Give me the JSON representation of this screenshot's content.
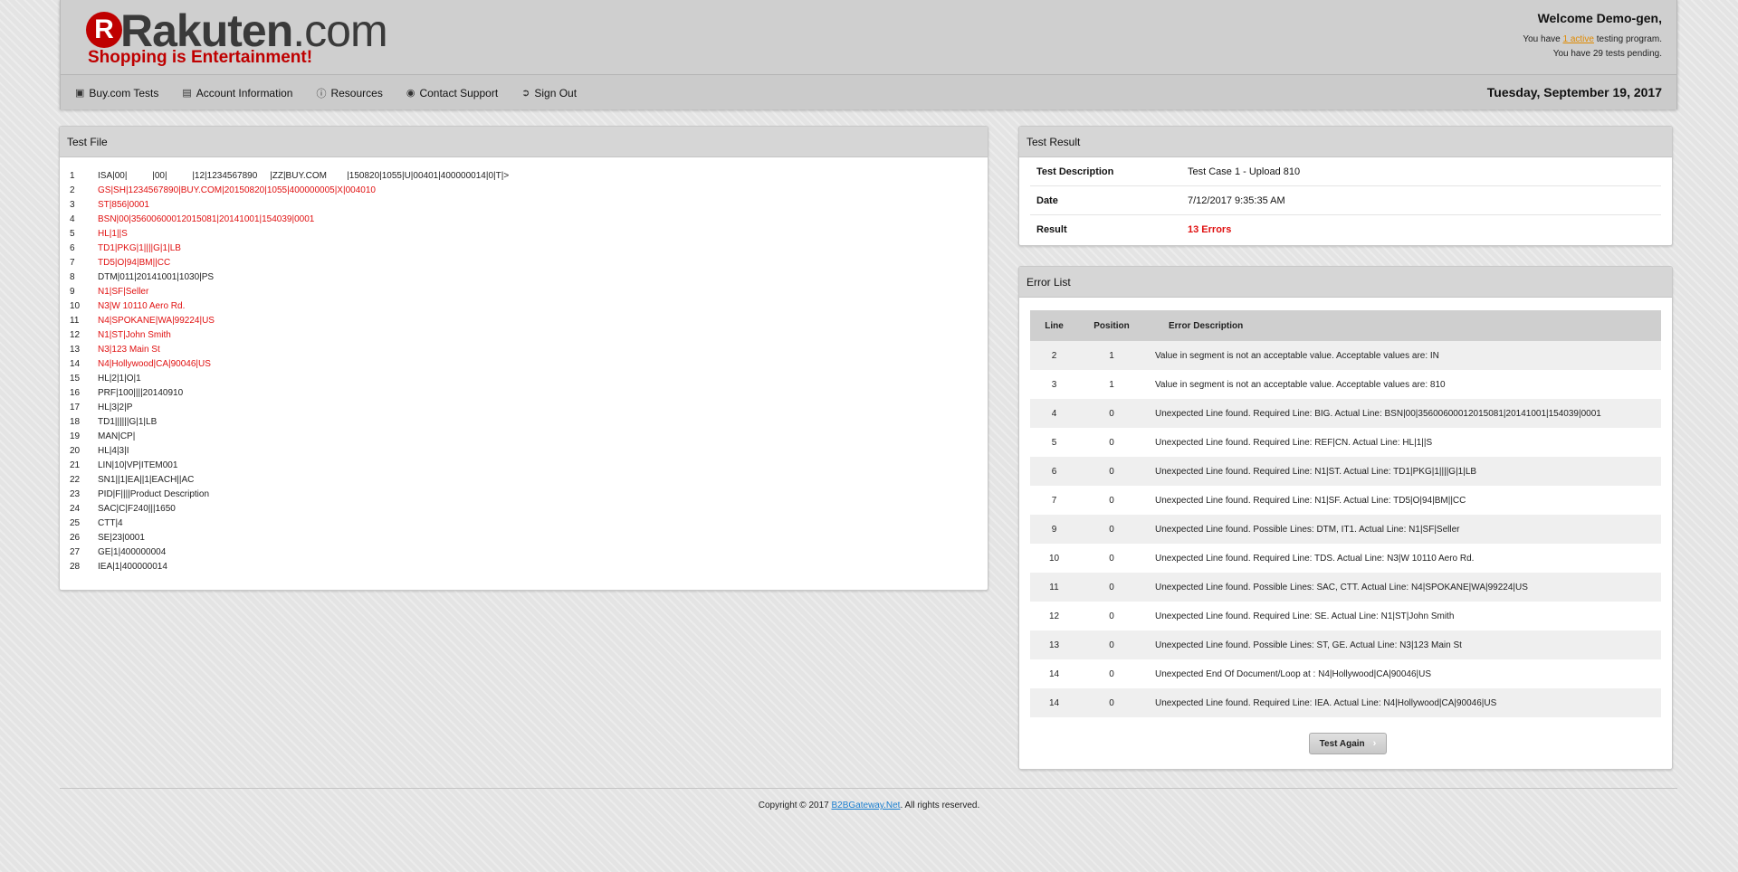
{
  "brand": {
    "logo_letter": "R",
    "logo_name": "Rakuten",
    "logo_suffix": ".com",
    "tagline": "Shopping is Entertainment!"
  },
  "welcome": {
    "title": "Welcome Demo-gen,",
    "line1_prefix": "You have ",
    "line1_link": "1 active",
    "line1_suffix": " testing program.",
    "line2": "You have 29 tests pending."
  },
  "nav": {
    "items": [
      {
        "label": "Buy.com Tests",
        "icon": "document-icon"
      },
      {
        "label": "Account Information",
        "icon": "id-card-icon"
      },
      {
        "label": "Resources",
        "icon": "info-icon"
      },
      {
        "label": "Contact Support",
        "icon": "eye-icon"
      },
      {
        "label": "Sign Out",
        "icon": "sign-out-icon"
      }
    ],
    "date": "Tuesday, September 19, 2017"
  },
  "test_file": {
    "title": "Test File",
    "lines": [
      {
        "n": "1",
        "text": "ISA|00|          |00|          |12|1234567890     |ZZ|BUY.COM        |150820|1055|U|00401|400000014|0|T|>",
        "error": false
      },
      {
        "n": "2",
        "text": "GS|SH|1234567890|BUY.COM|20150820|1055|400000005|X|004010",
        "error": true
      },
      {
        "n": "3",
        "text": "ST|856|0001",
        "error": true
      },
      {
        "n": "4",
        "text": "BSN|00|35600600012015081|20141001|154039|0001",
        "error": true
      },
      {
        "n": "5",
        "text": "HL|1||S",
        "error": true
      },
      {
        "n": "6",
        "text": "TD1|PKG|1||||G|1|LB",
        "error": true
      },
      {
        "n": "7",
        "text": "TD5|O|94|BM||CC",
        "error": true
      },
      {
        "n": "8",
        "text": "DTM|011|20141001|1030|PS",
        "error": false
      },
      {
        "n": "9",
        "text": "N1|SF|Seller",
        "error": true
      },
      {
        "n": "10",
        "text": "N3|W 10110 Aero Rd.",
        "error": true
      },
      {
        "n": "11",
        "text": "N4|SPOKANE|WA|99224|US",
        "error": true
      },
      {
        "n": "12",
        "text": "N1|ST|John Smith",
        "error": true
      },
      {
        "n": "13",
        "text": "N3|123 Main St",
        "error": true
      },
      {
        "n": "14",
        "text": "N4|Hollywood|CA|90046|US",
        "error": true
      },
      {
        "n": "15",
        "text": "HL|2|1|O|1",
        "error": false
      },
      {
        "n": "16",
        "text": "PRF|100||||20140910",
        "error": false
      },
      {
        "n": "17",
        "text": "HL|3|2|P",
        "error": false
      },
      {
        "n": "18",
        "text": "TD1||||||G|1|LB",
        "error": false
      },
      {
        "n": "19",
        "text": "MAN|CP|",
        "error": false
      },
      {
        "n": "20",
        "text": "HL|4|3|I",
        "error": false
      },
      {
        "n": "21",
        "text": "LIN|10|VP|ITEM001",
        "error": false
      },
      {
        "n": "22",
        "text": "SN1||1|EA||1|EACH||AC",
        "error": false
      },
      {
        "n": "23",
        "text": "PID|F||||Product Description",
        "error": false
      },
      {
        "n": "24",
        "text": "SAC|C|F240|||1650",
        "error": false
      },
      {
        "n": "25",
        "text": "CTT|4",
        "error": false
      },
      {
        "n": "26",
        "text": "SE|23|0001",
        "error": false
      },
      {
        "n": "27",
        "text": "GE|1|400000004",
        "error": false
      },
      {
        "n": "28",
        "text": "IEA|1|400000014",
        "error": false
      }
    ]
  },
  "test_result": {
    "title": "Test Result",
    "description_label": "Test Description",
    "description_value": "Test Case 1 - Upload 810",
    "date_label": "Date",
    "date_value": "7/12/2017 9:35:35 AM",
    "result_label": "Result",
    "result_value": "13 Errors"
  },
  "error_list": {
    "title": "Error List",
    "headers": {
      "line": "Line",
      "position": "Position",
      "description": "Error Description"
    },
    "rows": [
      {
        "line": "2",
        "position": "1",
        "description": "Value in segment is not an acceptable value. Acceptable values are: IN"
      },
      {
        "line": "3",
        "position": "1",
        "description": "Value in segment is not an acceptable value. Acceptable values are: 810"
      },
      {
        "line": "4",
        "position": "0",
        "description": "Unexpected Line found. Required Line: BIG. Actual Line: BSN|00|35600600012015081|20141001|154039|0001"
      },
      {
        "line": "5",
        "position": "0",
        "description": "Unexpected Line found. Required Line: REF|CN. Actual Line: HL|1||S"
      },
      {
        "line": "6",
        "position": "0",
        "description": "Unexpected Line found. Required Line: N1|ST. Actual Line: TD1|PKG|1||||G|1|LB"
      },
      {
        "line": "7",
        "position": "0",
        "description": "Unexpected Line found. Required Line: N1|SF. Actual Line: TD5|O|94|BM||CC"
      },
      {
        "line": "9",
        "position": "0",
        "description": "Unexpected Line found. Possible Lines: DTM, IT1. Actual Line: N1|SF|Seller"
      },
      {
        "line": "10",
        "position": "0",
        "description": "Unexpected Line found. Required Line: TDS. Actual Line: N3|W 10110 Aero Rd."
      },
      {
        "line": "11",
        "position": "0",
        "description": "Unexpected Line found. Possible Lines: SAC, CTT. Actual Line: N4|SPOKANE|WA|99224|US"
      },
      {
        "line": "12",
        "position": "0",
        "description": "Unexpected Line found. Required Line: SE. Actual Line: N1|ST|John Smith"
      },
      {
        "line": "13",
        "position": "0",
        "description": "Unexpected Line found. Possible Lines: ST, GE. Actual Line: N3|123 Main St"
      },
      {
        "line": "14",
        "position": "0",
        "description": "Unexpected End Of Document/Loop at : N4|Hollywood|CA|90046|US"
      },
      {
        "line": "14",
        "position": "0",
        "description": "Unexpected Line found. Required Line: IEA. Actual Line: N4|Hollywood|CA|90046|US"
      }
    ],
    "button_label": "Test Again"
  },
  "footer": {
    "prefix": "Copyright © 2017 ",
    "link": "B2BGateway.Net",
    "suffix": ". All rights reserved."
  }
}
